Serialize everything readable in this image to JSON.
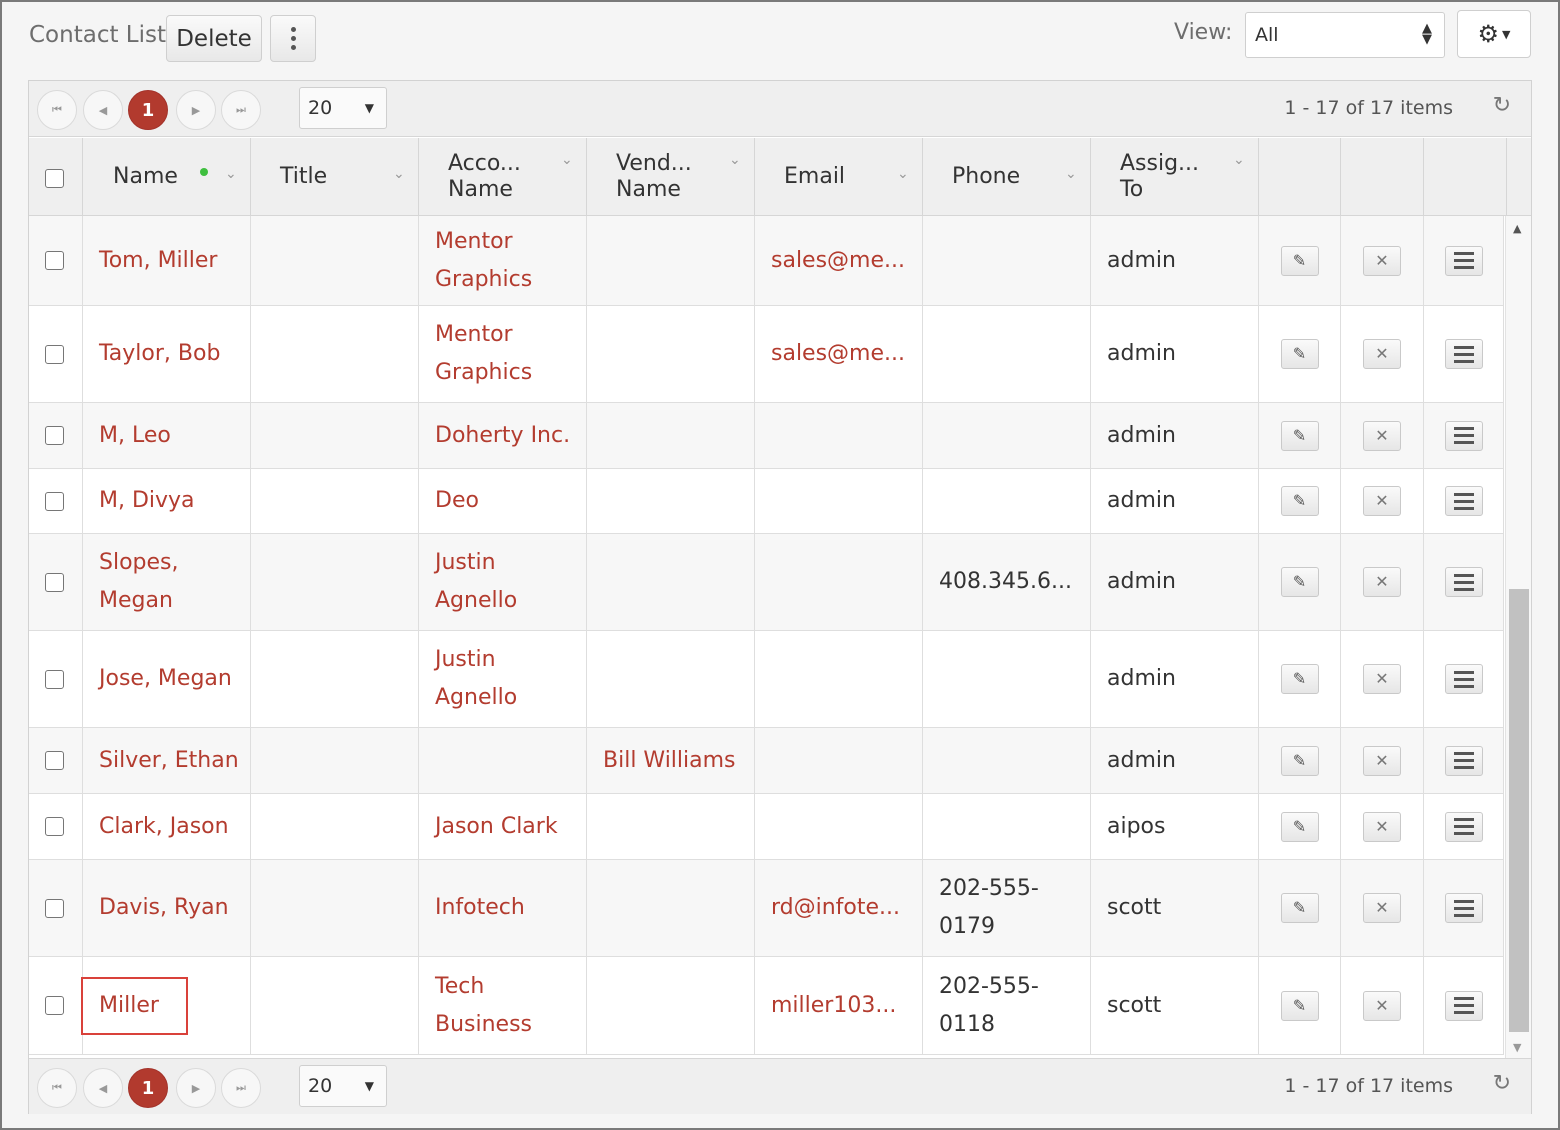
{
  "toolbar": {
    "title": "Contact List",
    "delete_label": "Delete",
    "view_label": "View:",
    "view_value": "All"
  },
  "pager": {
    "current_page": "1",
    "page_size": "20",
    "info": "1 - 17 of 17 items"
  },
  "columns": {
    "name": "Name",
    "title": "Title",
    "account_line1": "Acco...",
    "account_line2": "Name",
    "vendor_line1": "Vend...",
    "vendor_line2": "Name",
    "email": "Email",
    "phone": "Phone",
    "assigned_line1": "Assig...",
    "assigned_line2": "To"
  },
  "rows": [
    {
      "name": "Tom, Miller",
      "title": "",
      "account": "Mentor Graphics",
      "vendor": "",
      "email": "sales@me...",
      "phone": "",
      "assigned": "admin"
    },
    {
      "name": "Taylor, Bob",
      "title": "",
      "account": "Mentor Graphics",
      "vendor": "",
      "email": "sales@me...",
      "phone": "",
      "assigned": "admin"
    },
    {
      "name": "M, Leo",
      "title": "",
      "account": "Doherty Inc.",
      "vendor": "",
      "email": "",
      "phone": "",
      "assigned": "admin"
    },
    {
      "name": "M, Divya",
      "title": "",
      "account": "Deo",
      "vendor": "",
      "email": "",
      "phone": "",
      "assigned": "admin"
    },
    {
      "name": "Slopes, Megan",
      "title": "",
      "account": "Justin Agnello",
      "vendor": "",
      "email": "",
      "phone": "408.345.6...",
      "assigned": "admin"
    },
    {
      "name": "Jose, Megan",
      "title": "",
      "account": "Justin Agnello",
      "vendor": "",
      "email": "",
      "phone": "",
      "assigned": "admin"
    },
    {
      "name": "Silver, Ethan",
      "title": "",
      "account": "",
      "vendor": "Bill Williams",
      "email": "",
      "phone": "",
      "assigned": "admin"
    },
    {
      "name": "Clark, Jason",
      "title": "",
      "account": "Jason Clark",
      "vendor": "",
      "email": "",
      "phone": "",
      "assigned": "aipos"
    },
    {
      "name": "Davis, Ryan",
      "title": "",
      "account": "Infotech",
      "vendor": "",
      "email": "rd@infote...",
      "phone": "202-555-0179",
      "assigned": "scott"
    },
    {
      "name": "Miller",
      "title": "",
      "account": "Tech Business",
      "vendor": "",
      "email": "miller103...",
      "phone": "202-555-0118",
      "assigned": "scott"
    }
  ],
  "colors": {
    "link": "#b33c2f",
    "active_page": "#b23a2e",
    "highlight_box": "#d9413a",
    "sort_dot": "#3fbf3f"
  },
  "icons": {
    "edit": "pencil-icon",
    "delete": "close-icon",
    "menu": "hamburger-icon",
    "settings": "gear-icon",
    "refresh": "refresh-icon"
  }
}
